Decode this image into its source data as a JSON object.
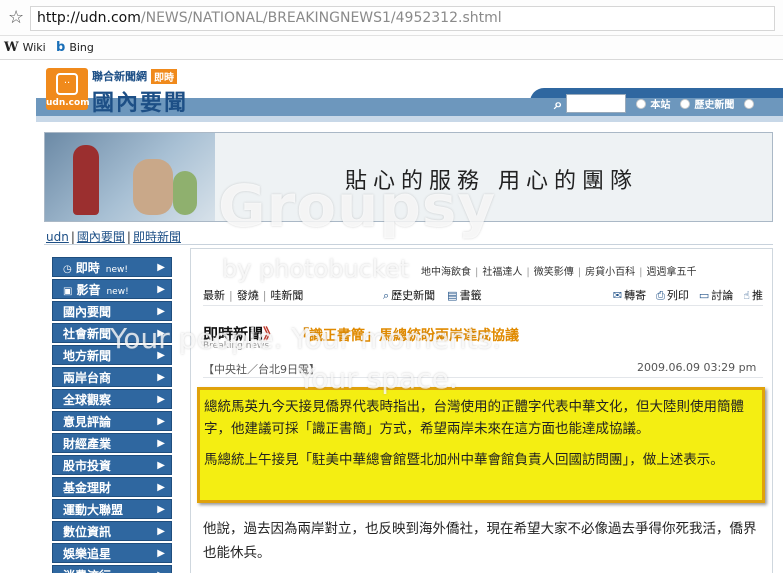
{
  "browser": {
    "url_host": "http://udn.com",
    "url_path": "/NEWS/NATIONAL/BREAKINGNEWS1/4952312.shtml",
    "bookmarks": [
      {
        "icon": "W",
        "label": "Wiki"
      },
      {
        "icon": "b",
        "label": "Bing"
      }
    ]
  },
  "header": {
    "logo_face": "··",
    "logo_udn": "udn.com",
    "network_name": "聯合新聞網",
    "live_badge": "即時",
    "section_name": "國內要聞",
    "search_value": "",
    "radio_site": "本站",
    "radio_history": "歷史新聞"
  },
  "banner": {
    "slogan": "貼心的服務  用心的團隊"
  },
  "breadcrumb": [
    "udn",
    "國內要聞",
    "即時新聞"
  ],
  "sidebar": {
    "items": [
      {
        "icon": "◷",
        "label": "即時",
        "badge": "new!"
      },
      {
        "icon": "▣",
        "label": "影音",
        "badge": "new!"
      },
      {
        "icon": "",
        "label": "國內要聞",
        "badge": ""
      },
      {
        "icon": "",
        "label": "社會新聞",
        "badge": ""
      },
      {
        "icon": "",
        "label": "地方新聞",
        "badge": ""
      },
      {
        "icon": "",
        "label": "兩岸台商",
        "badge": ""
      },
      {
        "icon": "",
        "label": "全球觀察",
        "badge": ""
      },
      {
        "icon": "",
        "label": "意見評論",
        "badge": ""
      },
      {
        "icon": "",
        "label": "財經產業",
        "badge": ""
      },
      {
        "icon": "",
        "label": "股市投資",
        "badge": ""
      },
      {
        "icon": "",
        "label": "基金理財",
        "badge": ""
      },
      {
        "icon": "",
        "label": "運動大聯盟",
        "badge": ""
      },
      {
        "icon": "",
        "label": "數位資訊",
        "badge": ""
      },
      {
        "icon": "",
        "label": "娛樂追星",
        "badge": ""
      },
      {
        "icon": "",
        "label": "消費流行",
        "badge": ""
      }
    ],
    "arrow": "▶"
  },
  "content": {
    "top_links": [
      "地中海飲食",
      "社福達人",
      "微笑影傳",
      "房貸小百科",
      "週週拿五千"
    ],
    "nav_links": [
      "最新",
      "發燒",
      "哇新聞"
    ],
    "tools_left": [
      {
        "icon": "⌕",
        "label": "歷史新聞"
      },
      {
        "icon": "▤",
        "label": "書籤"
      }
    ],
    "tools_right": [
      {
        "icon": "✉",
        "label": "轉寄"
      },
      {
        "icon": "⎙",
        "label": "列印"
      },
      {
        "icon": "▭",
        "label": "討論"
      },
      {
        "icon": "☝",
        "label": "推"
      }
    ],
    "section_title": "即時新聞",
    "section_chev": "》",
    "section_en": "Breaking news",
    "headline": "「識正書簡」馬總統盼兩岸達成協議",
    "source": "【中央社／台北9日電】",
    "date": "2009.06.09 03:29 pm",
    "highlight_p1": "總統馬英九今天接見僑界代表時指出，台灣使用的正體字代表中華文化，但大陸則使用簡體字，他建議可採「識正書簡」方式，希望兩岸未來在這方面也能達成協議。",
    "highlight_p2": "馬總統上午接見「駐美中華總會館暨北加州中華會館負責人回國訪問團」，做上述表示。",
    "para2": "他說，過去因為兩岸對立，也反映到海外僑社，現在希望大家不必像過去爭得你死我活，僑界也能休兵。"
  },
  "watermark": {
    "brand": "Groupsy",
    "by": "by photobucket",
    "line1": "Your people. Your moments.",
    "line2": "Your space."
  }
}
